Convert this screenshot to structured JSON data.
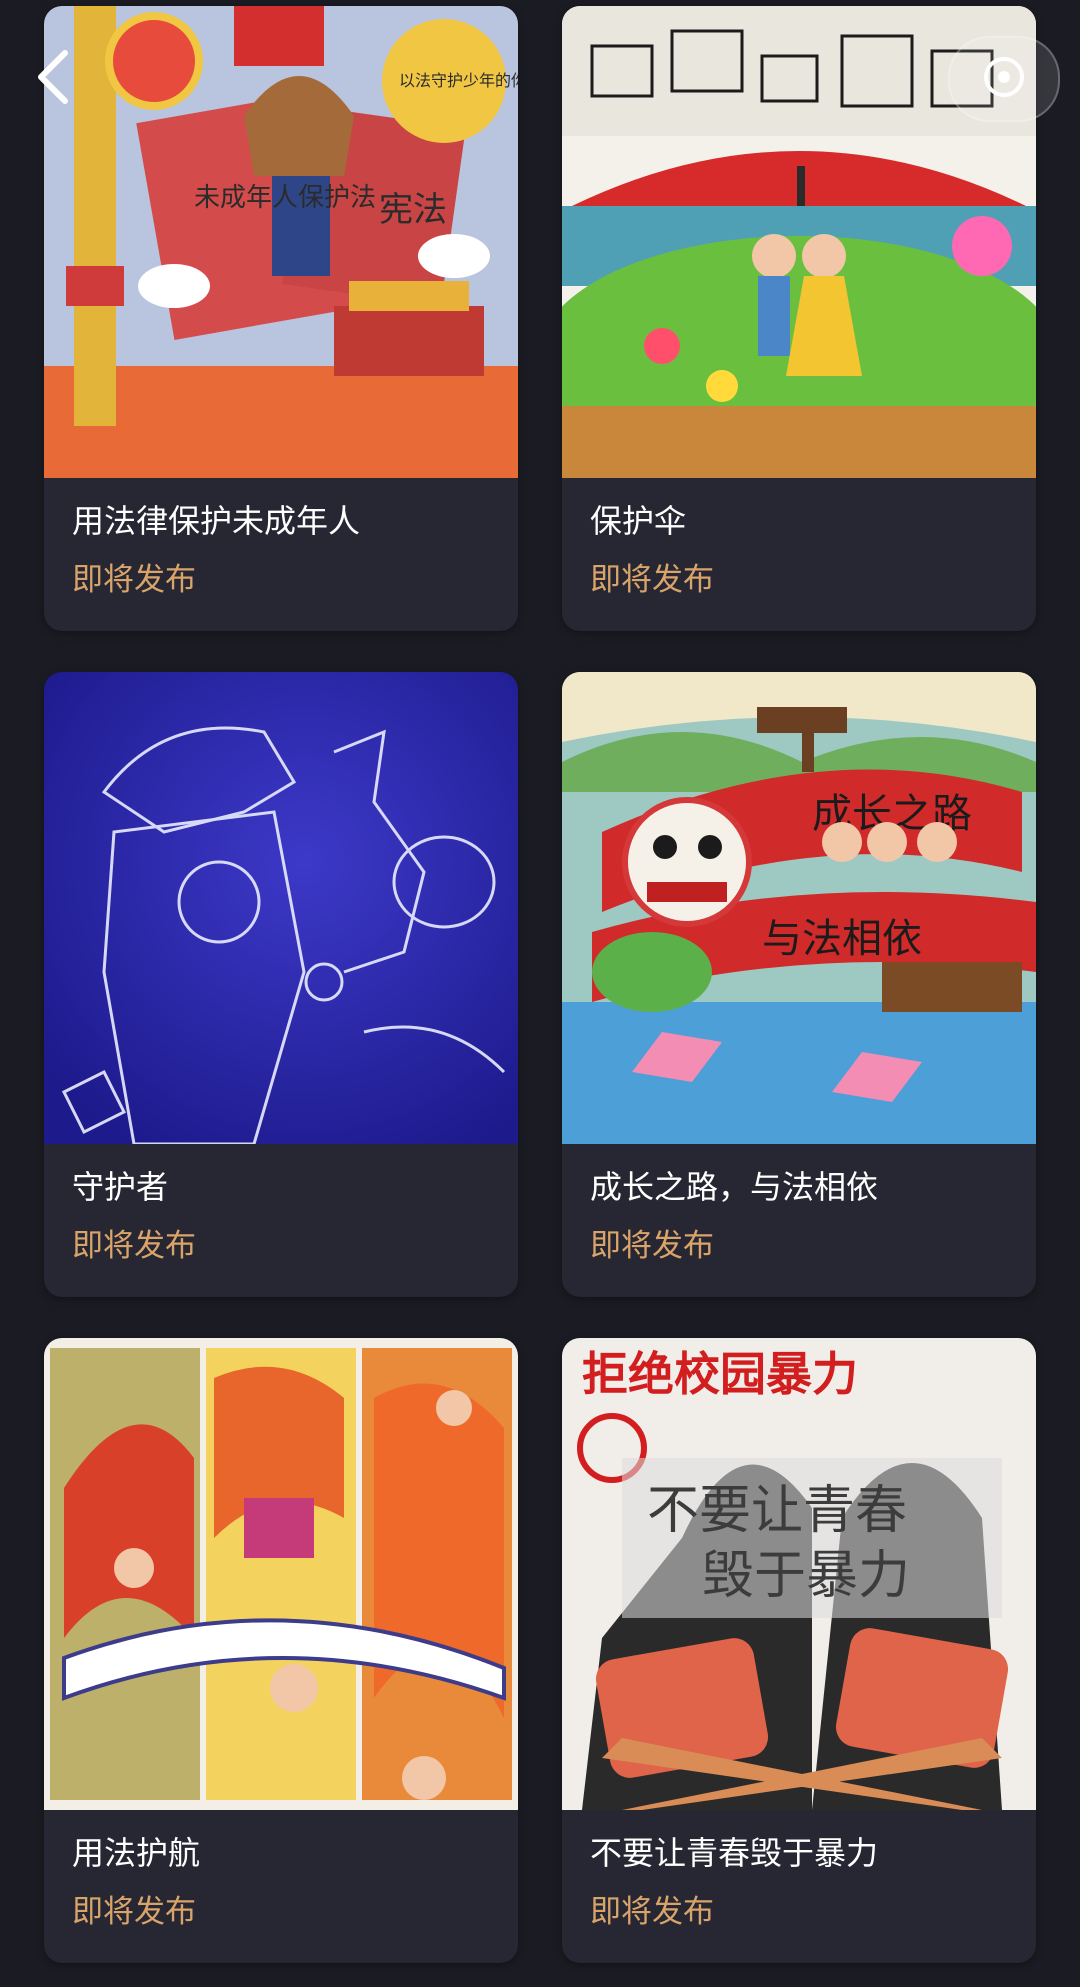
{
  "cards": [
    {
      "title": "用法律保护未成年人",
      "status": "即将发布",
      "art_hint": "constitution-poster-illustration"
    },
    {
      "title": "保护伞",
      "status": "即将发布",
      "art_hint": "umbrella-children-illustration"
    },
    {
      "title": "守护者",
      "status": "即将发布",
      "art_hint": "guardian-blue-line-art"
    },
    {
      "title": "成长之路，与法相依",
      "status": "即将发布",
      "art_hint": "lion-dance-lotus-illustration"
    },
    {
      "title": "用法护航",
      "status": "即将发布",
      "art_hint": "three-panel-comic-illustration"
    },
    {
      "title": "不要让青春毁于暴力",
      "status": "即将发布",
      "art_hint": "anti-school-violence-poster"
    }
  ],
  "artwork_text": {
    "card1_badge": "以法守护少年的你",
    "card1_book_left": "未成年人保护法",
    "card1_book_right": "宪法",
    "card4_banner_top": "成长之路",
    "card4_banner_bottom": "与法相依",
    "card6_headline": "拒绝校园暴力",
    "card6_slogan_1": "不要让青春",
    "card6_slogan_2": "毁于暴力"
  },
  "icons": {
    "back": "chevron-left-icon",
    "top_right": "circle-button-icon"
  }
}
